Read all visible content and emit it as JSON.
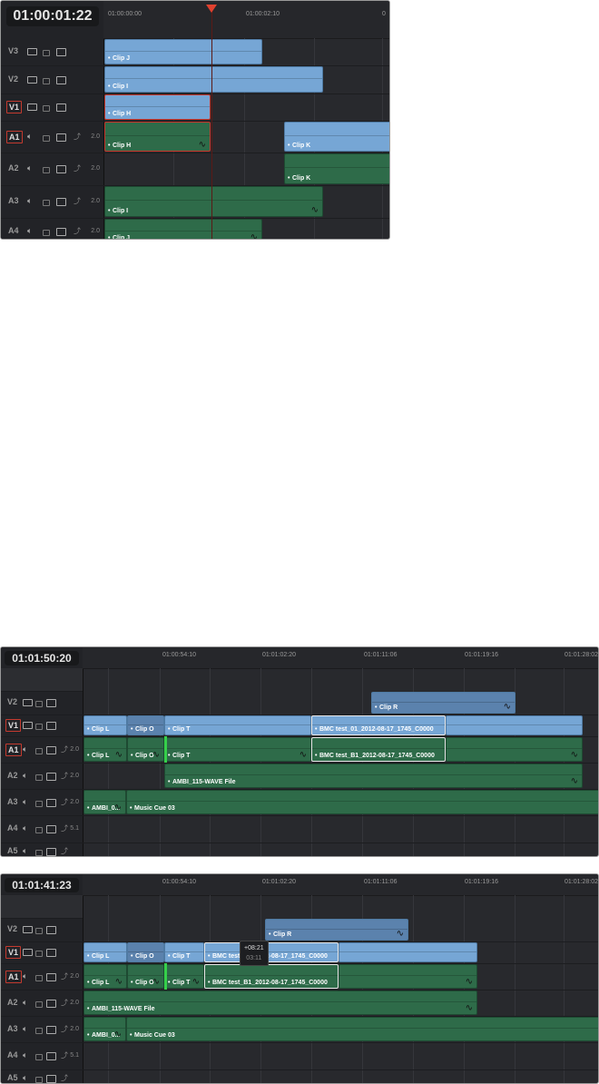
{
  "panels": [
    {
      "timecode": "01:00:01:22",
      "ruler": [
        "01:00:00:00",
        "01:00:02:10",
        "0"
      ],
      "tracks": [
        {
          "label": "V3",
          "type": "video"
        },
        {
          "label": "V2",
          "type": "video"
        },
        {
          "label": "V1",
          "type": "video",
          "active": true
        },
        {
          "label": "A1",
          "type": "audio",
          "channels": "2.0",
          "active": true
        },
        {
          "label": "A2",
          "type": "audio",
          "channels": "2.0"
        },
        {
          "label": "A3",
          "type": "audio",
          "channels": "2.0"
        },
        {
          "label": "A4",
          "type": "audio",
          "channels": "2.0"
        }
      ],
      "clips": [
        "Clip J",
        "Clip I",
        "Clip H",
        "Clip K",
        "Clip H",
        "Clip K",
        "Clip I",
        "Clip J"
      ]
    },
    {
      "timecode": "01:01:50:20",
      "ruler": [
        "01:00:54:10",
        "01:01:02:20",
        "01:01:11:06",
        "01:01:19:16",
        "01:01:28:02"
      ],
      "tracks": [
        {
          "label": "V2",
          "type": "video"
        },
        {
          "label": "V1",
          "type": "video",
          "active": true
        },
        {
          "label": "A1",
          "type": "audio",
          "channels": "2.0",
          "active": true
        },
        {
          "label": "A2",
          "type": "audio",
          "channels": "2.0"
        },
        {
          "label": "A3",
          "type": "audio",
          "channels": "2.0"
        },
        {
          "label": "A4",
          "type": "audio",
          "channels": "5.1"
        },
        {
          "label": "A5",
          "type": "audio"
        }
      ],
      "clips": [
        "Clip R",
        "Clip L",
        "Clip O",
        "Clip T",
        "BMC test_01_2012-08-17_1745_C0000",
        "",
        "Clip L",
        "Clip O",
        "Clip T",
        "BMC test_B1_2012-08-17_1745_C0000",
        "",
        "AMBI_115-WAVE File",
        "AMBI_0...",
        "Music Cue 03"
      ]
    },
    {
      "timecode": "01:01:41:23",
      "ruler": [
        "01:00:54:10",
        "01:01:02:20",
        "01:01:11:06",
        "01:01:19:16",
        "01:01:28:02"
      ],
      "tracks": [
        {
          "label": "V2",
          "type": "video"
        },
        {
          "label": "V1",
          "type": "video",
          "active": true
        },
        {
          "label": "A1",
          "type": "audio",
          "channels": "2.0",
          "active": true
        },
        {
          "label": "A2",
          "type": "audio",
          "channels": "2.0"
        },
        {
          "label": "A3",
          "type": "audio",
          "channels": "2.0"
        },
        {
          "label": "A4",
          "type": "audio",
          "channels": "5.1"
        },
        {
          "label": "A5",
          "type": "audio"
        }
      ],
      "clips": [
        "Clip R",
        "Clip L",
        "Clip O",
        "Clip T",
        "BMC test_B1_2012-08-17_1745_C0000",
        "",
        "Clip L",
        "Clip O",
        "Clip T",
        "BMC test_B1_2012-08-17_1745_C0000",
        "",
        "AMBI_115-WAVE File",
        "AMBI_0...",
        "Music Cue 03"
      ],
      "tooltip": {
        "offset": "+08:21",
        "duration": "03:11"
      }
    }
  ],
  "colors": {
    "video_clip": "#76a6d5",
    "audio_clip": "#2e6b49",
    "playhead": "#e0412f",
    "selection": "#c8352b",
    "edit_point": "#35d04a"
  }
}
